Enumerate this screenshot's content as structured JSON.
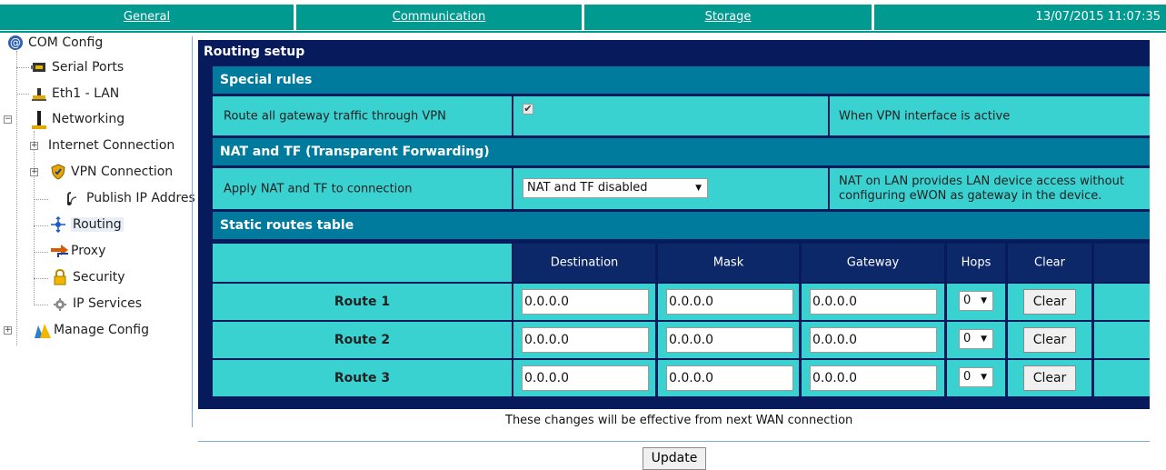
{
  "nav": {
    "tabs": [
      "General",
      "Communication",
      "Storage"
    ],
    "datetime": "13/07/2015 11:07:35"
  },
  "tree": {
    "root": "COM Config",
    "items": [
      {
        "label": "Serial Ports",
        "icon": "serial-port-icon"
      },
      {
        "label": "Eth1 - LAN",
        "icon": "lan-icon"
      },
      {
        "label": "Networking",
        "icon": "network-icon"
      },
      {
        "label": "Internet Connection",
        "icon": ""
      },
      {
        "label": "VPN Connection",
        "icon": "vpn-shield-icon"
      },
      {
        "label": "Publish IP Addres",
        "icon": "publish-icon"
      },
      {
        "label": "Routing",
        "icon": "routing-icon"
      },
      {
        "label": "Proxy",
        "icon": "proxy-icon"
      },
      {
        "label": "Security",
        "icon": "lock-icon"
      },
      {
        "label": "IP Services",
        "icon": "gear-icon"
      },
      {
        "label": "Manage Config",
        "icon": "manage-config-icon"
      }
    ]
  },
  "panel": {
    "title": "Routing setup",
    "special_rules": {
      "heading": "Special rules",
      "label": "Route all gateway traffic through VPN",
      "checked": true,
      "hint": "When VPN interface is active"
    },
    "nat": {
      "heading": "NAT and TF (Transparent Forwarding)",
      "label": "Apply NAT and TF to connection",
      "value": "NAT and TF disabled",
      "hint": "NAT on LAN provides LAN device access without configuring eWON as gateway in the device."
    },
    "static_routes": {
      "heading": "Static routes table",
      "columns": [
        "Destination",
        "Mask",
        "Gateway",
        "Hops",
        "Clear"
      ],
      "rows": [
        {
          "name": "Route 1",
          "destination": "0.0.0.0",
          "mask": "0.0.0.0",
          "gateway": "0.0.0.0",
          "hops": "0",
          "clear": "Clear"
        },
        {
          "name": "Route 2",
          "destination": "0.0.0.0",
          "mask": "0.0.0.0",
          "gateway": "0.0.0.0",
          "hops": "0",
          "clear": "Clear"
        },
        {
          "name": "Route 3",
          "destination": "0.0.0.0",
          "mask": "0.0.0.0",
          "gateway": "0.0.0.0",
          "hops": "0",
          "clear": "Clear"
        }
      ]
    }
  },
  "footer": {
    "note": "These changes will be effective from next WAN connection",
    "update_label": "Update"
  },
  "colors": {
    "teal": "#009a90",
    "panel_bg": "#061a5c",
    "section": "#007b9e",
    "cell": "#3ad1d1"
  }
}
